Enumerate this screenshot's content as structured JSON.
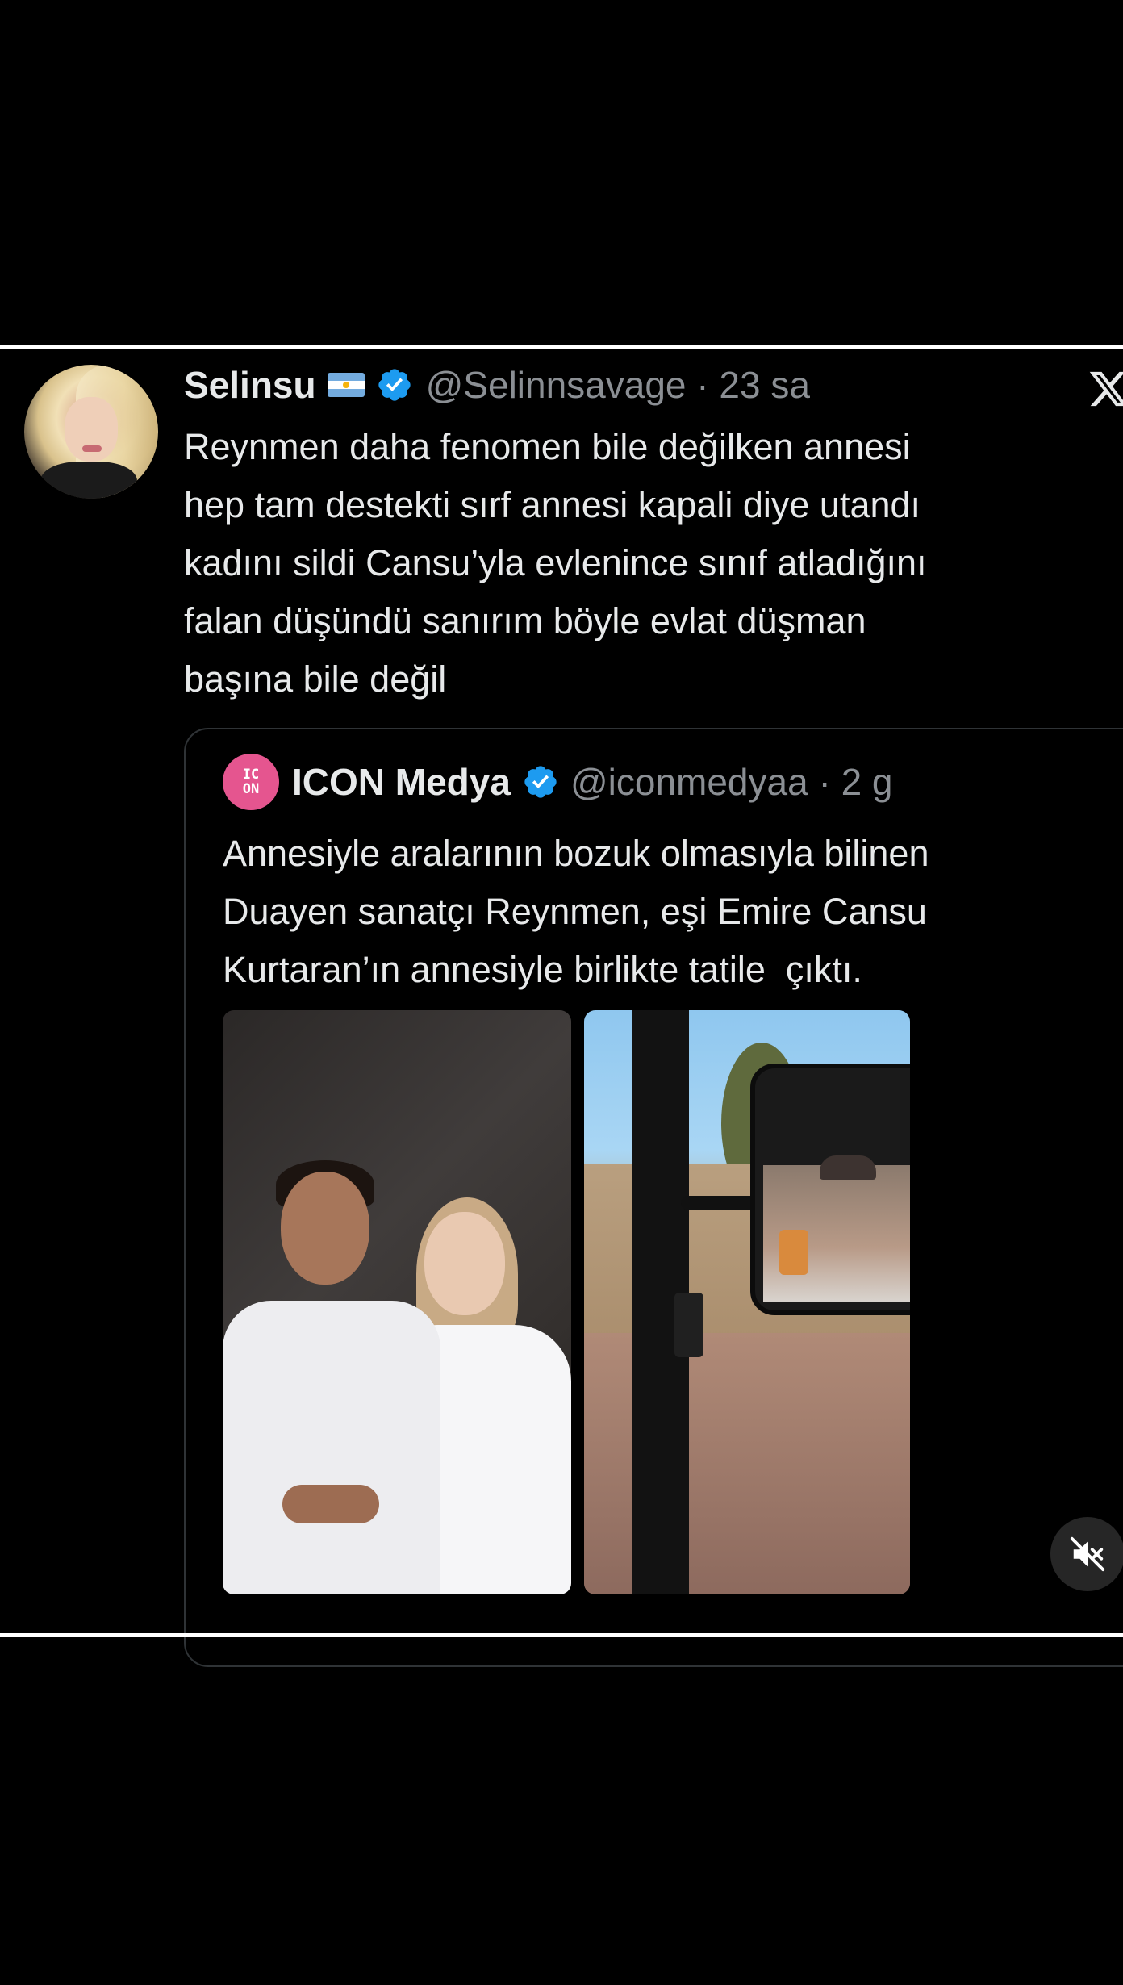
{
  "tweet": {
    "author": {
      "name": "Selinsu",
      "flag_icon": "argentina-flag-icon",
      "verified_icon": "verified-badge-icon",
      "handle_time": "@Selinnsavage · 23 sa"
    },
    "platform_icon": "x-logo-icon",
    "text": "Reynmen daha fenomen bile değilken annesi\nhep tam destekti sırf annesi kapali diye utandı\nkadını sildi Cansu’yla evlenince sınıf atladığını\nfalan düşündü sanırım böyle evlat düşman\nbaşına bile değil"
  },
  "quoted_tweet": {
    "avatar_text_top": "IC",
    "avatar_text_bottom": "ON",
    "name": "ICON Medya",
    "verified_icon": "verified-badge-icon",
    "handle_time": "@iconmedyaa · 2 g",
    "text": "Annesiyle aralarının bozuk olmasıyla bilinen\nDuayen sanatçı Reynmen, eşi Emire Cansu\nKurtaran’ın annesiyle birlikte tatile  çıktı.",
    "media": [
      "couple-bathrobes-photo",
      "golf-cart-mirror-photo"
    ]
  },
  "controls": {
    "mute_icon": "muted-speaker-icon"
  },
  "colors": {
    "background": "#000000",
    "text": "#e7e9ea",
    "secondary_text": "#8b8f94",
    "verified_blue": "#1d9bf0",
    "icon_pink": "#e5558f",
    "divider": "#ffffff"
  }
}
